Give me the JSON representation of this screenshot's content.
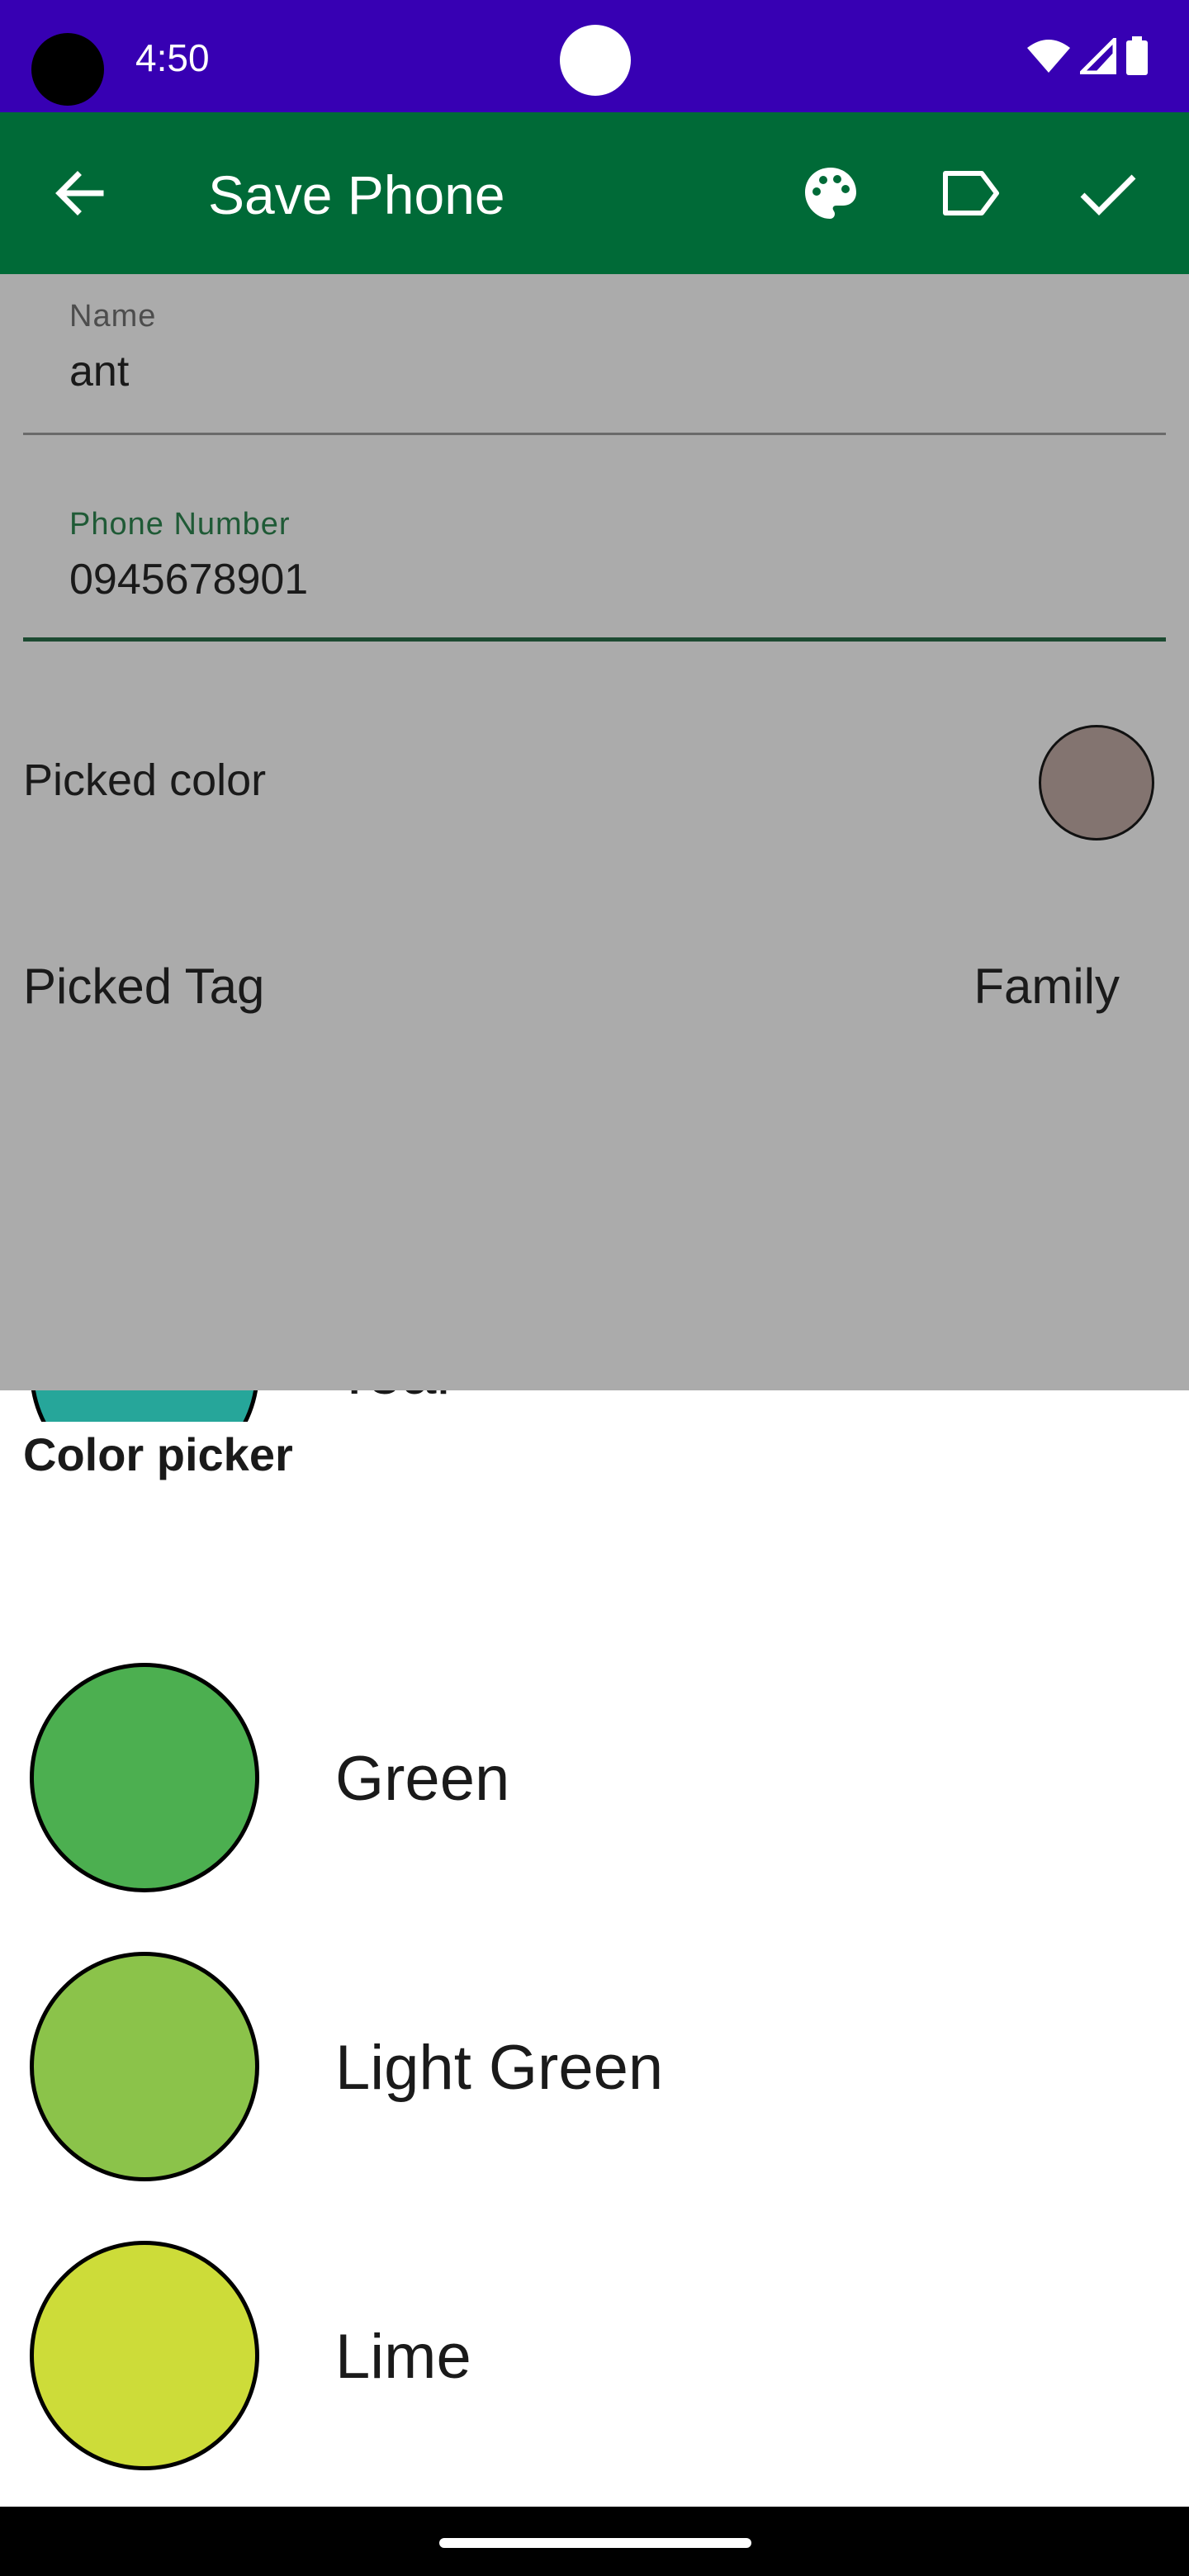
{
  "status_bar": {
    "time": "4:50"
  },
  "app_bar": {
    "title": "Save Phone",
    "back_icon": "arrow-left-icon",
    "actions": [
      "palette-icon",
      "tag-icon",
      "check-icon"
    ],
    "color": "#006a37"
  },
  "form": {
    "name_label": "Name",
    "name_value": "ant",
    "phone_label": "Phone Number",
    "phone_value": "0945678901",
    "picked_color_label": "Picked color",
    "picked_color": "#837470",
    "picked_tag_label": "Picked Tag",
    "picked_tag_value": "Family"
  },
  "sheet": {
    "title": "Color picker",
    "items": [
      {
        "name": "Teal",
        "color": "#26a69a"
      },
      {
        "name": "Green",
        "color": "#4caf50"
      },
      {
        "name": "Light Green",
        "color": "#8bc34a"
      },
      {
        "name": "Lime",
        "color": "#cddc39"
      }
    ]
  }
}
